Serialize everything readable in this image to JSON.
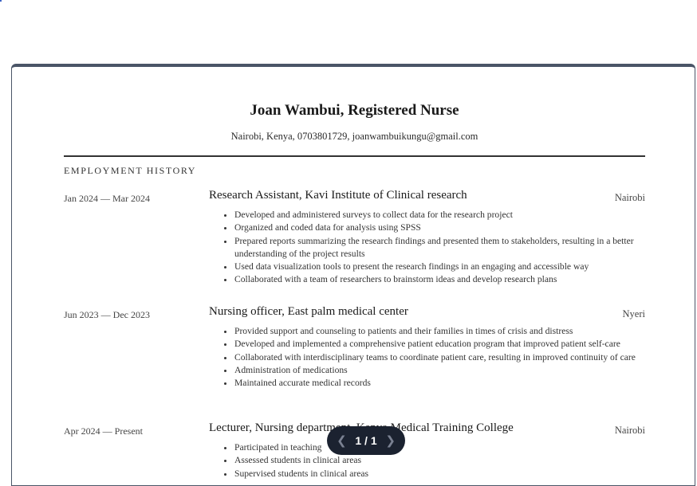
{
  "resume": {
    "name": "Joan Wambui, Registered Nurse",
    "contact": "Nairobi, Kenya, 0703801729, joanwambuikungu@gmail.com",
    "section_title": "EMPLOYMENT HISTORY",
    "jobs": [
      {
        "dates": "Jan 2024 — Mar 2024",
        "title": "Research Assistant, Kavi Institute of Clinical research",
        "city": "Nairobi",
        "bullets": [
          "Developed and administered surveys to collect data for the research project",
          "Organized and coded data for analysis using SPSS",
          "Prepared reports summarizing the research findings and presented them to stakeholders, resulting in a better understanding of the project results",
          "Used data visualization tools to present the research findings in an engaging and accessible way",
          "Collaborated with a team of researchers to brainstorm ideas and develop research plans"
        ]
      },
      {
        "dates": "Jun 2023 — Dec 2023",
        "title": "Nursing officer, East palm medical center",
        "city": "Nyeri",
        "bullets": [
          "Provided support and counseling to patients and their families in times of crisis and distress",
          "Developed and implemented a comprehensive patient education program that improved patient self-care",
          "Collaborated with interdisciplinary teams to coordinate patient care, resulting in improved continuity of care",
          "Administration of medications",
          "Maintained accurate medical records"
        ]
      },
      {
        "dates": "Apr 2024 — Present",
        "title": "Lecturer, Nursing department, Kenya Medical Training College",
        "city": "Nairobi",
        "bullets": [
          "Participated in teaching",
          "Assessed students in clinical areas",
          "Supervised students in clinical areas"
        ]
      }
    ]
  },
  "pager": {
    "label": "1 / 1",
    "prev_icon": "chevron-left-icon",
    "next_icon": "chevron-right-icon"
  },
  "colors": {
    "viewer_border": "#4a5567",
    "pager_bg": "#1b2230"
  }
}
